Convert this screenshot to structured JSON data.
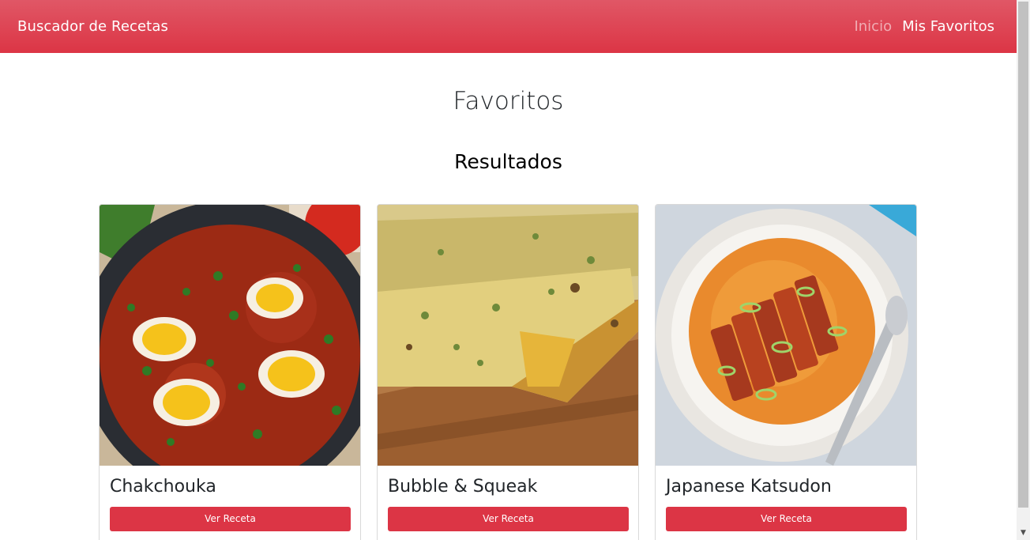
{
  "navbar": {
    "brand": "Buscador de Recetas",
    "links": [
      {
        "label": "Inicio",
        "active": false
      },
      {
        "label": "Mis Favoritos",
        "active": true
      }
    ]
  },
  "page_title": "Favoritos",
  "section_title": "Resultados",
  "recipes": [
    {
      "name": "Chakchouka",
      "button": "Ver Receta",
      "image": "shakshuka-pan-with-eggs"
    },
    {
      "name": "Bubble & Squeak",
      "button": "Ver Receta",
      "image": "bubble-and-squeak-slice"
    },
    {
      "name": "Japanese Katsudon",
      "button": "Ver Receta",
      "image": "katsu-curry-bowl"
    }
  ],
  "colors": {
    "accent": "#dc3545",
    "navbar_top": "#e05766"
  }
}
